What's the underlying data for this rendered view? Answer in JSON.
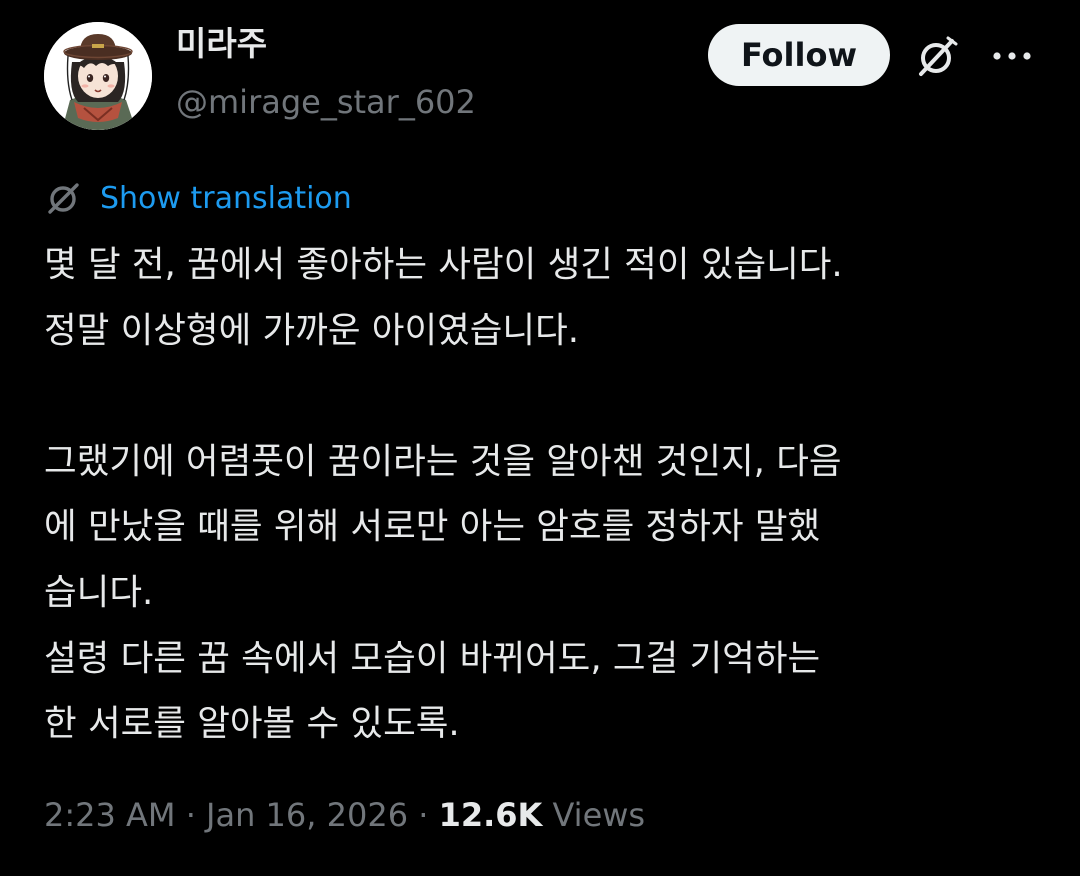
{
  "author": {
    "display_name": "미라주",
    "handle": "@mirage_star_602",
    "avatar_icon": "anime-character-avatar"
  },
  "actions": {
    "follow_label": "Follow",
    "grok_icon": "grok-icon",
    "more_icon": "more-horizontal-icon"
  },
  "translation": {
    "icon": "globe-icon",
    "label": "Show translation"
  },
  "tweet": {
    "text": "몇 달 전, 꿈에서 좋아하는 사람이 생긴 적이 있습니다.\n정말 이상형에 가까운 아이였습니다.\n\n그랬기에 어렴풋이 꿈이라는 것을 알아챈 것인지, 다음\n에 만났을 때를 위해 서로만 아는 암호를 정하자 말했\n습니다.\n설령 다른 꿈 속에서 모습이 바뀌어도, 그걸 기억하는\n한 서로를 알아볼 수 있도록."
  },
  "meta": {
    "time": "2:23 AM",
    "separator": "·",
    "date": "Jan 16, 2026",
    "views_count": "12.6K",
    "views_label": "Views"
  },
  "colors": {
    "background": "#000000",
    "text": "#e7e9ea",
    "secondary": "#71767b",
    "link": "#1d9bf0",
    "follow_bg": "#eff3f4"
  }
}
